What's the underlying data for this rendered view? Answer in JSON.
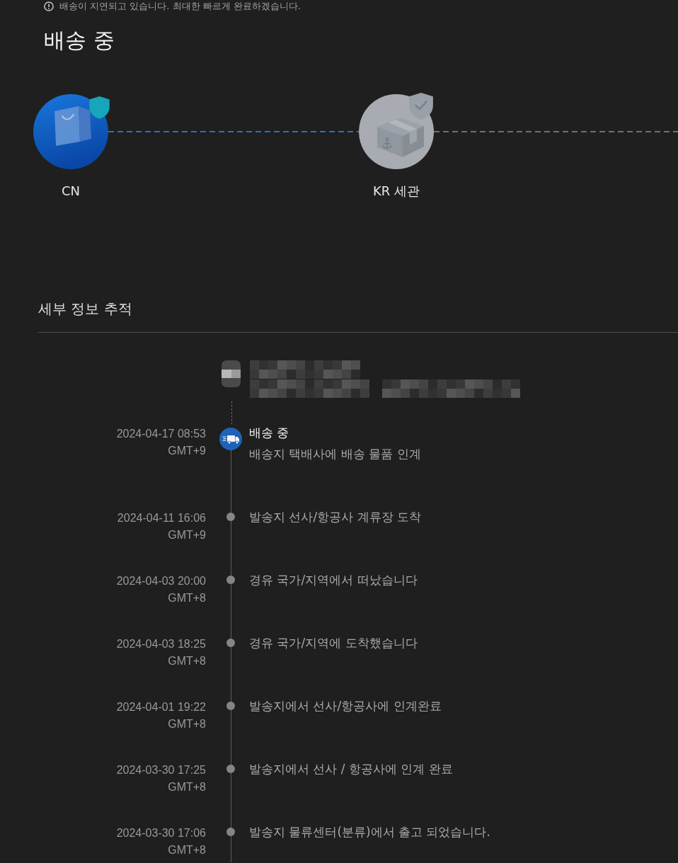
{
  "notice": {
    "text": "배송이 지연되고 있습니다. 최대한 빠르게 완료하겠습니다."
  },
  "status_title": "배송 중",
  "progress": {
    "nodes": [
      {
        "label": "CN",
        "kind": "origin",
        "reached": true
      },
      {
        "label": "KR 세관",
        "kind": "customs",
        "reached": false
      }
    ]
  },
  "tracking": {
    "title": "세부 정보 추적",
    "events": [
      {
        "date": "2024-04-17 08:53",
        "timezone": "GMT+9",
        "title": "배송 중",
        "detail": "배송지 택배사에 배송 물품 인계",
        "current": true
      },
      {
        "date": "2024-04-11 16:06",
        "timezone": "GMT+9",
        "title": "발송지 선사/항공사 계류장 도착",
        "current": false
      },
      {
        "date": "2024-04-03 20:00",
        "timezone": "GMT+8",
        "title": "경유 국가/지역에서 떠났습니다",
        "current": false
      },
      {
        "date": "2024-04-03 18:25",
        "timezone": "GMT+8",
        "title": "경유 국가/지역에 도착했습니다",
        "current": false
      },
      {
        "date": "2024-04-01 19:22",
        "timezone": "GMT+8",
        "title": "발송지에서 선사/항공사에 인계완료",
        "current": false
      },
      {
        "date": "2024-03-30 17:25",
        "timezone": "GMT+8",
        "title": "발송지에서 선사 / 항공사에 인계 완료",
        "current": false
      },
      {
        "date": "2024-03-30 17:06",
        "timezone": "GMT+8",
        "title": "발송지 물류센터(분류)에서 출고 되었습니다.",
        "current": false
      }
    ]
  }
}
